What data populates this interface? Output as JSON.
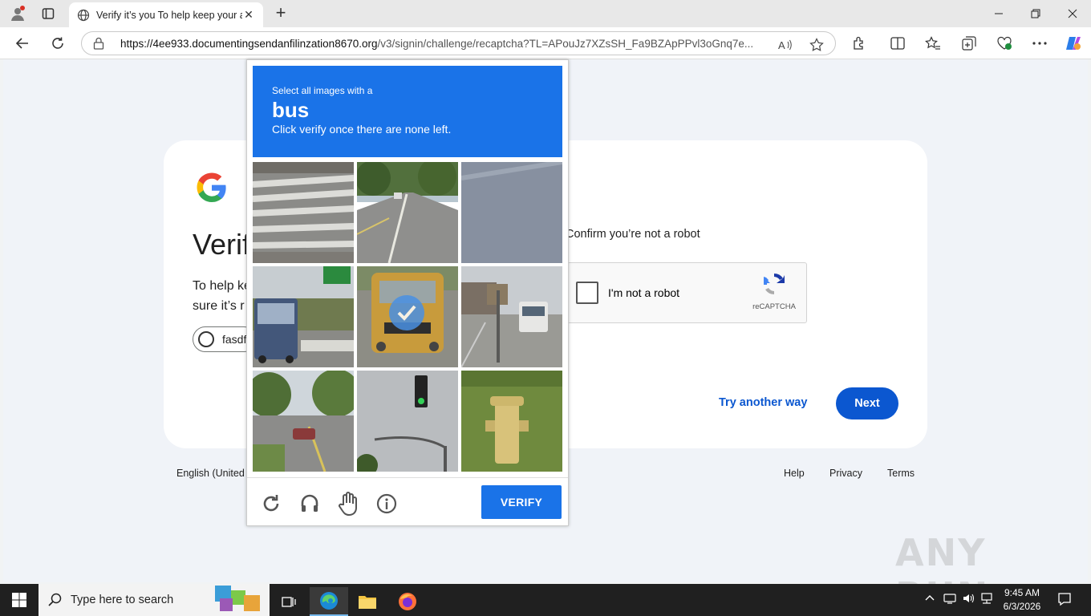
{
  "browser": {
    "tab_title": "Verify it’s you To help keep your a",
    "url_domain": "https://4ee933.documentingsendanfilinzation8670.org",
    "url_path": "/v3/signin/challenge/recaptcha?TL=APouJz7XZsSH_Fa9BZApPPvl3oGnq7e..."
  },
  "page": {
    "heading": "Verif",
    "help_text_line1": "To help ke",
    "help_text_line2": "sure it’s r",
    "account_chip": "fasdf",
    "confirm_text": "Confirm you’re not a robot",
    "recaptcha_label": "I'm not a robot",
    "recaptcha_brand": "reCAPTCHA",
    "try_another_way": "Try another way",
    "next_label": "Next",
    "footer_language": "English (United",
    "footer_help": "Help",
    "footer_privacy": "Privacy",
    "footer_terms": "Terms"
  },
  "challenge": {
    "line1": "Select all images with a",
    "target": "bus",
    "line3": "Click verify once there are none left.",
    "verify_label": "VERIFY",
    "tiles": [
      {
        "icon": "crosswalk-image",
        "selected": false
      },
      {
        "icon": "road-image",
        "selected": false
      },
      {
        "icon": "wall-image",
        "selected": false
      },
      {
        "icon": "bus-highway-image",
        "selected": false
      },
      {
        "icon": "school-bus-image",
        "selected": true
      },
      {
        "icon": "street-bus-image",
        "selected": false
      },
      {
        "icon": "street-trees-image",
        "selected": false
      },
      {
        "icon": "traffic-light-image",
        "selected": false
      },
      {
        "icon": "hydrant-image",
        "selected": false
      }
    ]
  },
  "watermark": "ANY RUN",
  "taskbar": {
    "search_placeholder": "Type here to search",
    "time": "9:45 AM",
    "date": "6/3/2026"
  },
  "colors": {
    "google_blue": "#0b57d0",
    "captcha_blue": "#1a73e8",
    "taskbar": "#202020"
  }
}
